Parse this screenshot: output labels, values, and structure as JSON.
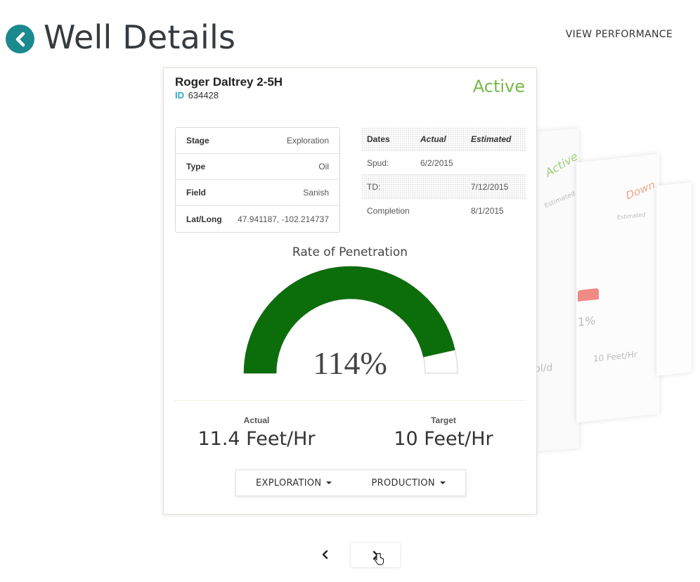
{
  "header": {
    "title": "Well Details",
    "view_performance": "VIEW PERFORMANCE"
  },
  "well": {
    "name": "Roger Daltrey 2-5H",
    "id_label": "ID",
    "id": "634428",
    "status": "Active"
  },
  "info": [
    {
      "key": "Stage",
      "value": "Exploration"
    },
    {
      "key": "Type",
      "value": "Oil"
    },
    {
      "key": "Field",
      "value": "Sanish"
    },
    {
      "key": "Lat/Long",
      "value": "47.941187, -102.214737"
    }
  ],
  "dates": {
    "headers": [
      "Dates",
      "Actual",
      "Estimated"
    ],
    "rows": [
      {
        "label": "Spud:",
        "actual": "6/2/2015",
        "estimated": ""
      },
      {
        "label": "TD:",
        "actual": "",
        "estimated": "7/12/2015"
      },
      {
        "label": "Completion",
        "actual": "",
        "estimated": "8/1/2015"
      }
    ]
  },
  "gauge": {
    "title": "Rate of Penetration",
    "value_text": "114%",
    "fill_fraction": 0.93,
    "fill_color": "#0b6e0b"
  },
  "metrics": {
    "actual_label": "Actual",
    "actual_value": "11.4 Feet/Hr",
    "target_label": "Target",
    "target_value": "10 Feet/Hr"
  },
  "menus": {
    "exploration": "EXPLORATION",
    "production": "PRODUCTION"
  },
  "ghost_cards": {
    "status_active": "Active",
    "status_down": "Down",
    "estimated": "Estimated",
    "percent": "1%",
    "rate": "10 Feet/Hr",
    "unit": "bl/d"
  },
  "colors": {
    "accent": "#1b8a8f",
    "active": "#7ab648",
    "down": "#f1a38a",
    "gauge": "#0b6e0b"
  }
}
